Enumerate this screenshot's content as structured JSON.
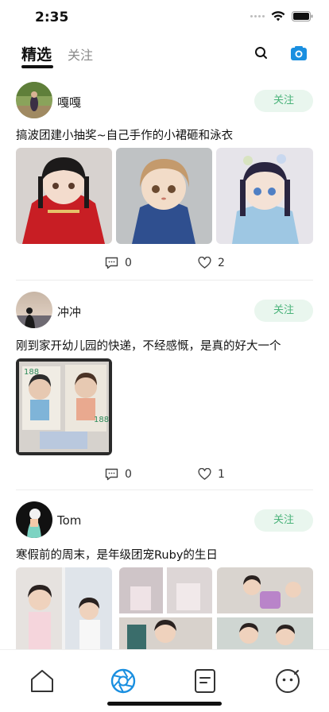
{
  "status_bar": {
    "time": "2:35"
  },
  "header": {
    "tabs": [
      {
        "label": "精选"
      },
      {
        "label": "关注"
      }
    ],
    "search_icon": "search-icon",
    "camera_icon": "camera-icon",
    "accent_color": "#1a8fe0"
  },
  "posts": [
    {
      "username": "嘎嘎",
      "follow_label": "关注",
      "text": "搞波团建小抽奖~自己手作的小裙砸和泳衣",
      "comments": "0",
      "likes": "2"
    },
    {
      "username": "冲冲",
      "follow_label": "关注",
      "text": "刚到家开幼儿园的快递，不经感慨，是真的好大一个",
      "comments": "0",
      "likes": "1"
    },
    {
      "username": "Tom",
      "follow_label": "关注",
      "text": "寒假前的周末，是年级团宠Ruby的生日"
    }
  ],
  "tabbar": {
    "items": [
      {
        "icon": "home-icon"
      },
      {
        "icon": "aperture-icon",
        "active": true
      },
      {
        "icon": "notes-icon"
      },
      {
        "icon": "face-icon"
      }
    ],
    "active_color": "#1a8fe0"
  },
  "colors": {
    "follow_bg": "#e9f6ee",
    "follow_text": "#4ab37a"
  }
}
